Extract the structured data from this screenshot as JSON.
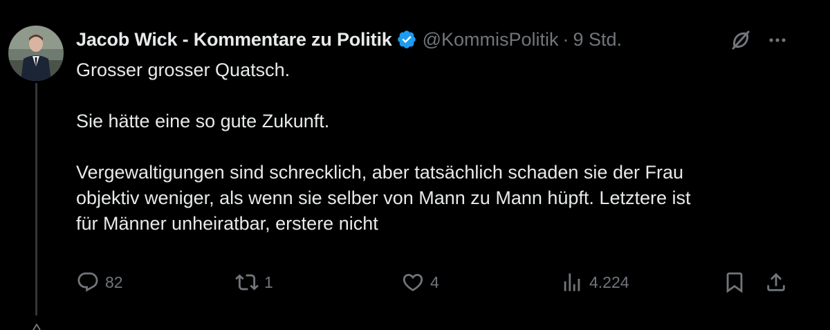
{
  "tweet": {
    "author": {
      "display_name": "Jacob Wick - Kommentare zu Politik",
      "handle": "@KommisPolitik",
      "verified": true,
      "avatar": "profile-photo"
    },
    "separator": "·",
    "time": "9 Std.",
    "text_lines": [
      "Grosser grosser Quatsch.",
      "",
      "Sie hätte eine so gute Zukunft.",
      "",
      "Vergewaltigungen sind schrecklich, aber tatsächlich schaden sie der Frau",
      "objektiv weniger, als wenn sie selber von Mann zu Mann hüpft. Letztere ist",
      "für Männer unheiratbar, erstere nicht"
    ],
    "actions": {
      "reply": {
        "icon": "reply-icon",
        "count": "82"
      },
      "repost": {
        "icon": "repost-icon",
        "count": "1"
      },
      "like": {
        "icon": "heart-icon",
        "count": "4"
      },
      "views": {
        "icon": "views-icon",
        "count": "4.224"
      },
      "bookmark": {
        "icon": "bookmark-icon"
      },
      "share": {
        "icon": "share-icon"
      }
    },
    "header_icons": {
      "grok": "grok-icon",
      "more": "more-icon"
    }
  },
  "colors": {
    "background": "#000000",
    "text_primary": "#e7e9ea",
    "text_secondary": "#71767b",
    "verified_blue": "#1d9bf0",
    "thread_line": "#333639"
  }
}
